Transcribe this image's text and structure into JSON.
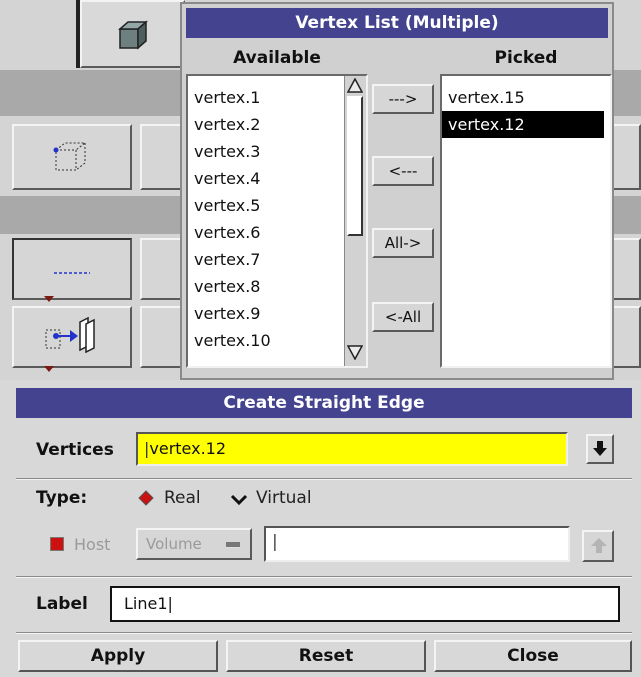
{
  "vertex_list": {
    "title": "Vertex List (Multiple)",
    "available_header": "Available",
    "picked_header": "Picked",
    "available": [
      "vertex.1",
      "vertex.2",
      "vertex.3",
      "vertex.4",
      "vertex.5",
      "vertex.6",
      "vertex.7",
      "vertex.8",
      "vertex.9",
      "vertex.10"
    ],
    "picked": [
      "vertex.15",
      "vertex.12"
    ],
    "selected_picked": "vertex.12",
    "buttons": {
      "add": "--->",
      "remove": "<---",
      "add_all": "All->",
      "remove_all": "<-All"
    }
  },
  "form": {
    "title": "Create Straight Edge",
    "vertices_label": "Vertices",
    "vertices_value": "vertex.12",
    "type_label": "Type:",
    "type_real": "Real",
    "type_virtual": "Virtual",
    "host_label": "Host",
    "host_option": "Volume",
    "host_value": "",
    "label_label": "Label",
    "label_value": "Line1",
    "apply": "Apply",
    "reset": "Reset",
    "close": "Close"
  },
  "colors": {
    "title_bar": "#43438f",
    "vertices_field": "#ffff00",
    "selection": "#000000",
    "radio_real": "#cc1111",
    "host_check": "#cc1111"
  }
}
